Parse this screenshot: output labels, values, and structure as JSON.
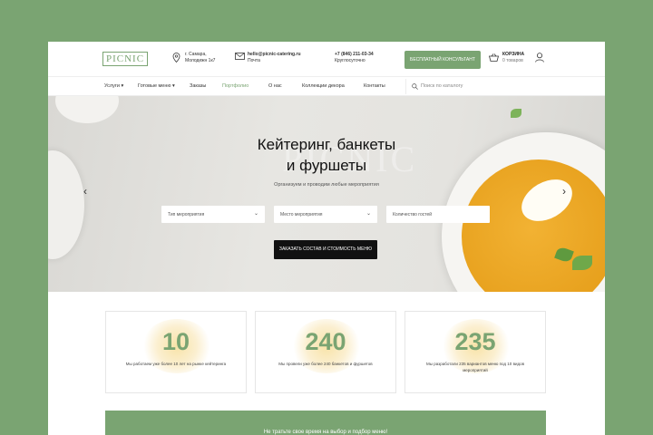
{
  "header": {
    "logo_text": "PICNIC",
    "address_line1": "г. Самара,",
    "address_line2": "Молодежн 1к7",
    "email": "hello@picnic-catering.ru",
    "email_label": "Почта",
    "phone": "+7 (846) 211-03-34",
    "phone_label": "Круглосуточно",
    "callback_button": "БЕСПЛАТНЫЙ КОНСУЛЬТАНТ",
    "cart_label": "КОРЗИНА",
    "cart_sub": "0 товаров"
  },
  "nav": {
    "items": [
      {
        "label": "Услуги ▾",
        "active": false
      },
      {
        "label": "Готовые меню ▾",
        "active": false
      },
      {
        "label": "Заказы",
        "active": false
      },
      {
        "label": "Портфолио",
        "active": true
      },
      {
        "label": "О нас",
        "active": false
      },
      {
        "label": "Коллекции декора",
        "active": false
      },
      {
        "label": "Контакты",
        "active": false
      }
    ],
    "search_placeholder": "Поиск по каталогу"
  },
  "hero": {
    "watermark": "PICNIC",
    "title_line1": "Кейтеринг, банкеты",
    "title_line2": "и фуршеты",
    "subtitle": "Организуем и проводим любые мероприятия",
    "select_event_type": "Тип мероприятия",
    "select_place": "Место мероприятия",
    "input_guests": "Количество гостей",
    "cta_button": "ЗАКАЗАТЬ СОСТАВ И СТОИМОСТЬ МЕНЮ"
  },
  "stats": [
    {
      "number": "10",
      "desc": "Мы работаем уже более 10 лет на рынке кейтеринга"
    },
    {
      "number": "240",
      "desc": "Мы провели уже более 240 банкетов и фуршетов"
    },
    {
      "number": "235",
      "desc": "Мы разработали 235 вариантов меню под 10 видов мероприятий"
    }
  ],
  "banner": {
    "text": "Не тратьте свое время на выбор и подбор меню!"
  },
  "colors": {
    "accent": "#7aa472",
    "background": "#7aa472",
    "button_dark": "#111111"
  }
}
